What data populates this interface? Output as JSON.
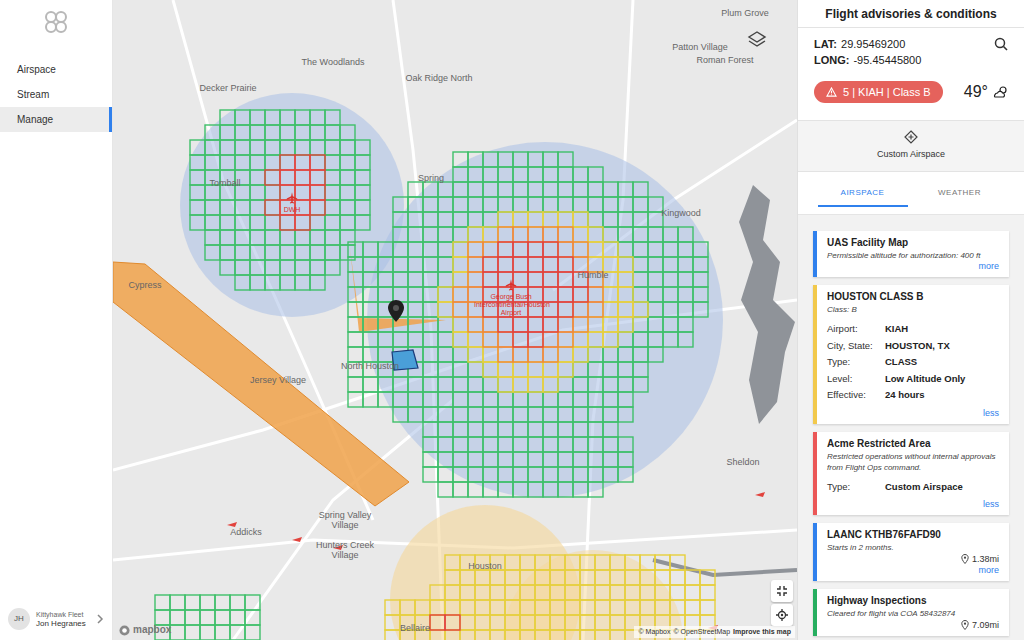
{
  "sidebar": {
    "items": [
      {
        "label": "Airspace",
        "selected": false
      },
      {
        "label": "Stream",
        "selected": false
      },
      {
        "label": "Manage",
        "selected": true
      }
    ],
    "user": {
      "initials": "JH",
      "org": "Kittyhawk Fleet",
      "name": "Jon Hegranes"
    }
  },
  "map": {
    "labels": [
      "Plum Grove",
      "Patton Village",
      "Roman Forest",
      "The Woodlands",
      "Oak Ridge North",
      "Decker Prairie",
      "Tomball",
      "Spring",
      "Kingwood",
      "Humble",
      "Cypress",
      "North Houston",
      "Jersey Village",
      "Addicks",
      "Spring Valley Village",
      "Hunters Creek Village",
      "Houston",
      "Bellaire",
      "Sheldon"
    ],
    "airports": [
      "DWH",
      "George Bush Intercontinental/Houston Airport"
    ],
    "cell_colors": [
      "#3fbf6a",
      "#e6cf3c",
      "#f08a3a",
      "#e2433d"
    ],
    "grids": [
      {
        "rows": [
          "000000011111111000000000",
          "000000011111111110000000",
          "000011111111111111110000",
          "000111111111111111111000",
          "000111111122222211111000",
          "000111112233333221111110",
          "111111123344443322111111",
          "111111123444444322211111",
          "111111123444444432211111",
          "111111233444444432211111",
          "111111233444444332221111",
          "111111123344443322211110",
          "111111122334433222111110",
          "111111112233332211111000",
          "111111111222222111110000",
          "111111111122221111110000",
          "111111111111111111100000",
          "000111111111111111100000",
          "000001111111111111000000",
          "000001111111111111100000",
          "000001111111111111100000",
          "000001111111111111100000",
          "000000111111111110000000"
        ]
      },
      {
        "rows": [
          "001111111100",
          "011111111110",
          "111111111111",
          "111111444111",
          "111114444111",
          "111111444111",
          "111114444111",
          "111111441111",
          "011111111110",
          "011111111110",
          "001111111100",
          "000111111000"
        ]
      },
      {
        "rows": [
          "0000222222222222222200",
          "0000222222222222222222",
          "0002222222222222222222",
          "2222222222222222222222",
          "2224422222222222222222",
          "2222222222222222222222"
        ]
      },
      {
        "rows": [
          "1111111",
          "1111111",
          "1111111"
        ]
      }
    ],
    "logo": "mapbox",
    "credits": [
      "© Mapbox",
      "© OpenStreetMap",
      "Improve this map"
    ]
  },
  "panel": {
    "title": "Flight advisories & conditions",
    "lat_label": "LAT:",
    "lat": "29.95469200",
    "long_label": "LONG:",
    "long": "-95.45445800",
    "advisory": "5 | KIAH | Class B",
    "temperature": "49°",
    "custom_airspace": "Custom Airspace",
    "tabs": [
      {
        "label": "AIRSPACE",
        "selected": true
      },
      {
        "label": "WEATHER",
        "selected": false
      }
    ],
    "cards": [
      {
        "title": "UAS Facility Map",
        "subtitle": "Permissible altitude for authorization: 400 ft",
        "color": "#2f80ed",
        "expanded": false,
        "fields": [],
        "toggle": "more"
      },
      {
        "title": "HOUSTON CLASS B",
        "subtitle": "Class: B",
        "color": "#f2c94c",
        "expanded": true,
        "fields": [
          {
            "label": "Airport:",
            "value": "KIAH"
          },
          {
            "label": "City, State:",
            "value": "HOUSTON, TX"
          },
          {
            "label": "Type:",
            "value": "CLASS"
          },
          {
            "label": "Level:",
            "value": "Low Altitude Only"
          },
          {
            "label": "Effective:",
            "value": "24 hours"
          }
        ],
        "toggle": "less"
      },
      {
        "title": "Acme Restricted Area",
        "subtitle": "Restricted operations without internal approvals from Flight Ops command.",
        "color": "#eb5757",
        "expanded": true,
        "fields": [
          {
            "label": "Type:",
            "value": "Custom Airspace"
          }
        ],
        "toggle": "less"
      },
      {
        "title": "LAANC KTHB76FAFD90",
        "subtitle": "Starts in 2 months.",
        "color": "#2f80ed",
        "expanded": false,
        "fields": [],
        "distance": "1.38mi",
        "toggle": "more"
      },
      {
        "title": "Highway Inspections",
        "subtitle": "Cleared for flight via COA 58432874",
        "color": "#27ae60",
        "fields": [],
        "distance": "7.09mi"
      }
    ]
  }
}
